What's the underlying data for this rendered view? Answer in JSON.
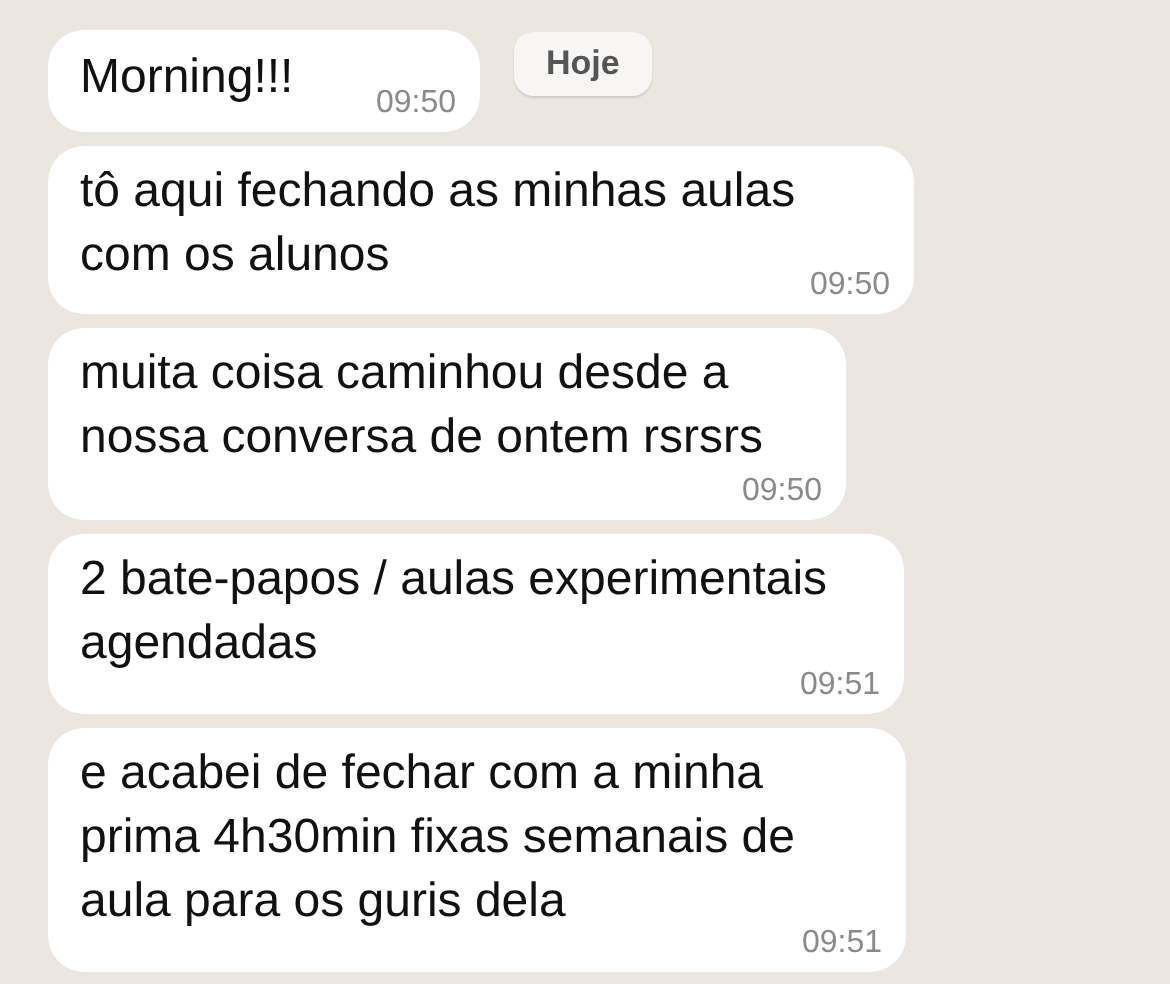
{
  "date_chip": "Hoje",
  "messages": [
    {
      "text": "Morning!!!",
      "time": "09:50"
    },
    {
      "text": "tô aqui fechando as minhas aulas com os alunos",
      "time": "09:50"
    },
    {
      "text": "muita coisa caminhou desde a nossa conversa de ontem rsrsrs",
      "time": "09:50"
    },
    {
      "text": "2 bate-papos / aulas experimentais agendadas",
      "time": "09:51"
    },
    {
      "text": "e acabei de fechar com a minha prima 4h30min fixas semanais de aula para os guris dela",
      "time": "09:51"
    }
  ]
}
